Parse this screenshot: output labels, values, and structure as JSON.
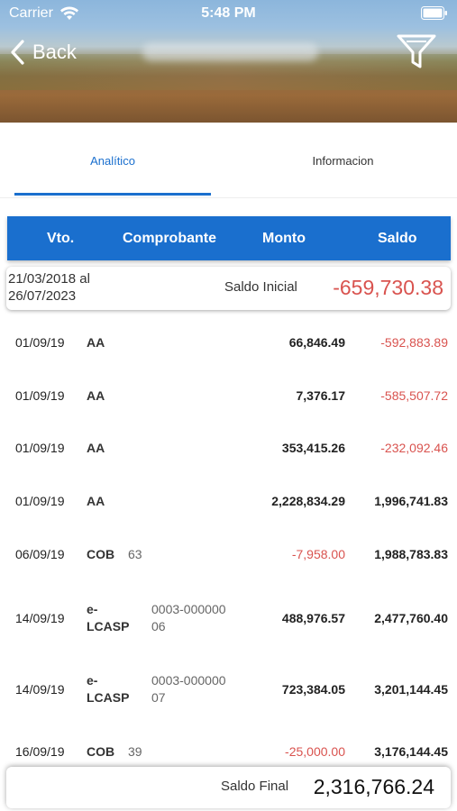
{
  "status_bar": {
    "carrier": "Carrier",
    "time": "5:48 PM"
  },
  "nav": {
    "back_label": "Back"
  },
  "tabs": [
    {
      "label": "Analítico",
      "active": true
    },
    {
      "label": "Informacion",
      "active": false
    }
  ],
  "table": {
    "headers": {
      "vto": "Vto.",
      "comprobante": "Comprobante",
      "monto": "Monto",
      "saldo": "Saldo"
    },
    "saldo_inicial": {
      "range_from": "21/03/2018 al",
      "range_to": "26/07/2023",
      "label": "Saldo Inicial",
      "value": "-659,730.38"
    },
    "rows": [
      {
        "date": "01/09/19",
        "type": "AA",
        "number": "",
        "monto": "66,846.49",
        "saldo": "-592,883.89"
      },
      {
        "date": "01/09/19",
        "type": "AA",
        "number": "",
        "monto": "7,376.17",
        "saldo": "-585,507.72"
      },
      {
        "date": "01/09/19",
        "type": "AA",
        "number": "",
        "monto": "353,415.26",
        "saldo": "-232,092.46"
      },
      {
        "date": "01/09/19",
        "type": "AA",
        "number": "",
        "monto": "2,228,834.29",
        "saldo": "1,996,741.83"
      },
      {
        "date": "06/09/19",
        "type": "COB",
        "number": "63",
        "monto": "-7,958.00",
        "saldo": "1,988,783.83"
      },
      {
        "date": "14/09/19",
        "type_line1": "e-",
        "type_line2": "LCASP",
        "number_line1": "0003-000000",
        "number_line2": "06",
        "monto": "488,976.57",
        "saldo": "2,477,760.40"
      },
      {
        "date": "14/09/19",
        "type_line1": "e-",
        "type_line2": "LCASP",
        "number_line1": "0003-000000",
        "number_line2": "07",
        "monto": "723,384.05",
        "saldo": "3,201,144.45"
      },
      {
        "date": "16/09/19",
        "type": "COB",
        "number": "39",
        "monto": "-25,000.00",
        "saldo": "3,176,144.45"
      }
    ],
    "saldo_final": {
      "label": "Saldo Final",
      "value": "2,316,766.24"
    }
  },
  "colors": {
    "accent": "#1a6fce",
    "negative": "#d9534f"
  },
  "icons": {
    "back": "chevron-left-icon",
    "filter": "filter-icon",
    "wifi": "wifi-icon",
    "battery": "battery-icon"
  }
}
